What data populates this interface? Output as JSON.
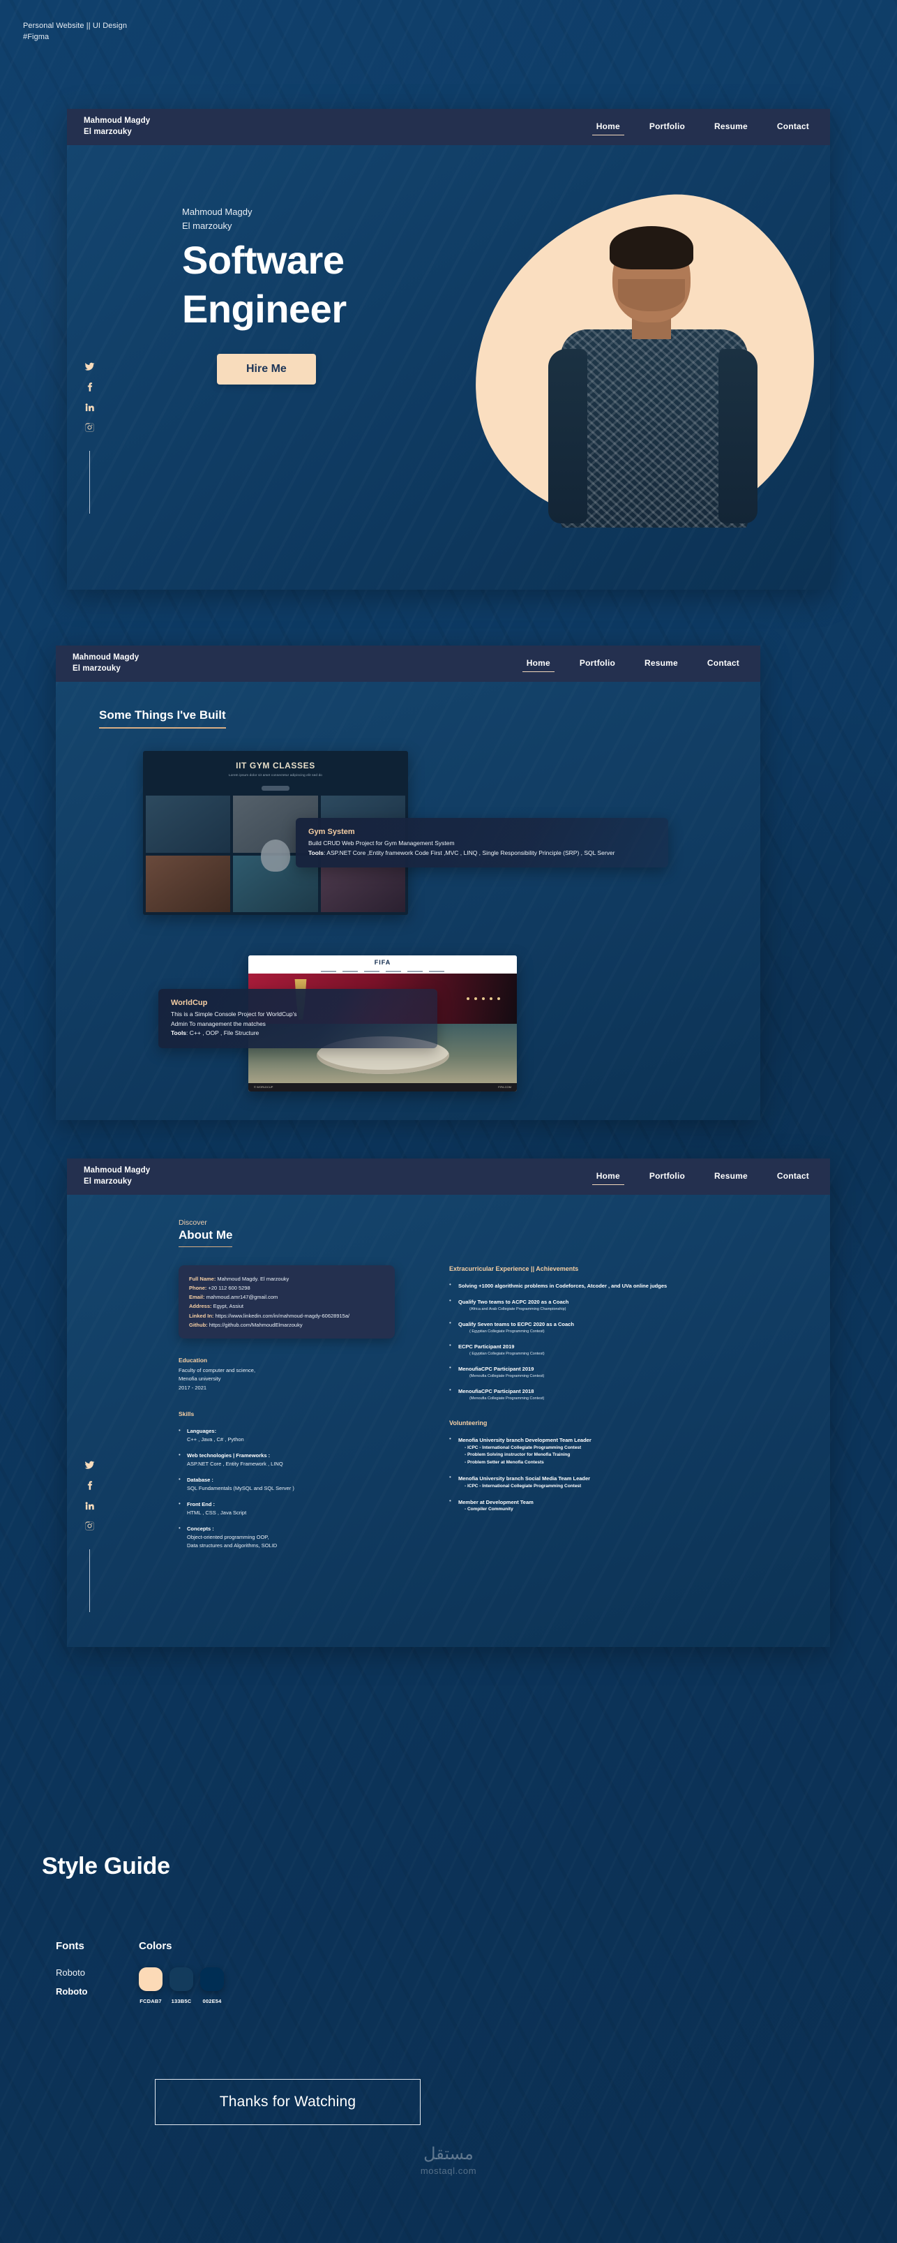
{
  "credit": {
    "line1": "Personal Website || UI Design",
    "line2": "#Figma"
  },
  "brand": {
    "line1": "Mahmoud Magdy",
    "line2": "El marzouky"
  },
  "nav": {
    "home": "Home",
    "portfolio": "Portfolio",
    "resume": "Resume",
    "contact": "Contact"
  },
  "hero": {
    "eyebrow1": "Mahmoud Magdy",
    "eyebrow2": "El marzouky",
    "title1": "Software",
    "title2": "Engineer",
    "cta": "Hire Me",
    "socials": [
      "twitter-icon",
      "facebook-icon",
      "linkedin-icon",
      "instagram-icon"
    ]
  },
  "portfolio": {
    "heading": "Some Things I've Built",
    "projects": [
      {
        "title": "Gym System",
        "desc": "Build CRUD Web Project for  Gym Management System",
        "tools_label": "Tools",
        "tools": ": ASP.NET Core ,Entity framework Code First ,MVC , LINQ , Single Responsibility Principle (SRP) , SQL Server",
        "shot_title": "IIT GYM CLASSES",
        "shot_sub": "Lorem ipsum dolor sit amet consectetur adipiscing elit sed do"
      },
      {
        "title": "WorldCup",
        "desc1": "This is a Simple Console Project for WorldCup's",
        "desc2": "Admin To management the matches",
        "tools_label": "Tools",
        "tools": ": C++ , OOP , File Structure",
        "shot_logo": "FIFA",
        "shot_bar_left": "© WORLDCUP",
        "shot_bar_right": "FIFA.COM"
      }
    ]
  },
  "about": {
    "eyebrow": "Discover",
    "heading": "About Me",
    "info": [
      {
        "label": "Full Name:",
        "value": " Mahmoud Magdy. El marzouky"
      },
      {
        "label": "Phone:",
        "value": " +20 112 600 5298"
      },
      {
        "label": "Email:",
        "value": " mahmoud.amr147@gmail.com"
      },
      {
        "label": "Address:",
        "value": " Egypt, Assiut"
      },
      {
        "label": "Linked In:",
        "value": " https://www.linkedin.com/in/mahmoud-magdy-60628915a/"
      },
      {
        "label": "Github:",
        "value": " https://github.com/MahmoudElmarzouky"
      }
    ],
    "education": {
      "heading": "Education",
      "line1": "Faculty of computer and science,",
      "line2": "Menofia university",
      "line3": "2017 - 2021"
    },
    "skills": {
      "heading": "Skills",
      "items": [
        {
          "label": "Languages:",
          "value": "C++ , Java , C# , Python"
        },
        {
          "label": "Web technologies | Frameworks :",
          "value": "ASP.NET Core , Entity Framework , LINQ"
        },
        {
          "label": "Database :",
          "value": "SQL Fundamentals (MySQL and SQL Server )"
        },
        {
          "label": "Front End :",
          "value": "HTML , CSS , Java Script"
        },
        {
          "label": "Concepts :",
          "value": "Object-oriented programming OOP,\nData structures and Algorithms, SOLID"
        }
      ]
    },
    "achievements": {
      "heading": "Extracurricular Experience || Achievements",
      "items": [
        {
          "main": "Solving +1000 algorithmic problems in Codeforces, Atcoder , and UVa online judges",
          "sub": ""
        },
        {
          "main": "Qualify Two teams to ACPC 2020 as a Coach",
          "sub": "(Africa and Arab Collegiate Programming Championship)"
        },
        {
          "main": "Qualify Seven teams to ECPC 2020 as a Coach",
          "sub": "( Egyptian Collegiate Programming Contest)"
        },
        {
          "main": "ECPC Participant 2019",
          "sub": "( Egyptian Collegiate Programming Contest)"
        },
        {
          "main": "MenoufiaCPC Participant 2019",
          "sub": "(Menoufia Collegiate Programming Contest)"
        },
        {
          "main": "MenoufiaCPC Participant 2018",
          "sub": "(Menoufia Collegiate Programming Contest)"
        }
      ]
    },
    "volunteering": {
      "heading": "Volunteering",
      "items": [
        {
          "main": "Menofia University branch Development Team Leader",
          "lines": "- ICPC - International Collegiate Programming Contest\n- Problem Solving instructor for Menofia Training\n- Problem Setter at Menofia Contests"
        },
        {
          "main": "Menofia University branch Social Media Team Leader",
          "lines": "- ICPC - International Collegiate Programming Contest"
        },
        {
          "main": "Member at Development Team",
          "lines": "- Compiler Community"
        }
      ]
    }
  },
  "style_guide": {
    "title": "Style Guide",
    "fonts_heading": "Fonts",
    "font_regular": "Roboto",
    "font_bold": "Roboto",
    "colors_heading": "Colors",
    "swatches": [
      {
        "hex": "#FCDAB7",
        "label": "FCDAB7"
      },
      {
        "hex": "#133B5C",
        "label": "133B5C"
      },
      {
        "hex": "#002E54",
        "label": "002E54"
      }
    ]
  },
  "footer": {
    "thanks": "Thanks for Watching",
    "watermark_ar": "مستقل",
    "watermark_en": "mostaql.com"
  }
}
